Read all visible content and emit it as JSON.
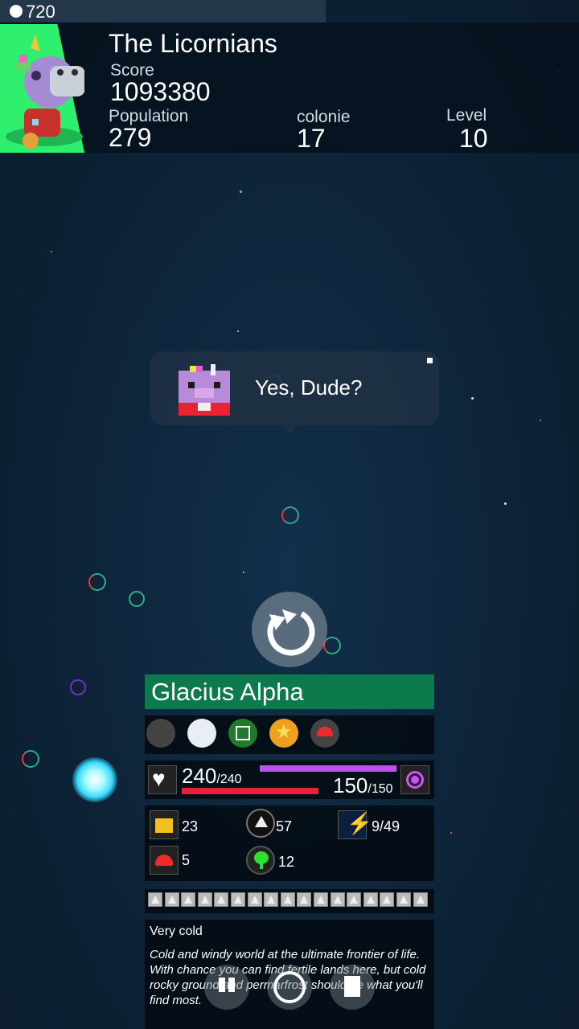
{
  "top_bar": {
    "coins": "720"
  },
  "header": {
    "civ_name": "The Licornians",
    "score_label": "Score",
    "score_value": "1093380",
    "population_label": "Population",
    "population_value": "279",
    "colonies_label": "colonie",
    "colonies_value": "17",
    "level_label": "Level",
    "level_value": "10"
  },
  "bubble": {
    "text": "Yes, Dude?"
  },
  "planet": {
    "name": "Glacius Alpha",
    "health_current": "240",
    "health_max": "/240",
    "health_fraction": 1.0,
    "energy_current": "150",
    "energy_max": "/150",
    "energy_fraction": 1.0,
    "stats": {
      "buildings": "23",
      "ships": "57",
      "energy": "9/49",
      "domes": "5",
      "trees": "12"
    },
    "description_title": "Very cold",
    "description_body": "Cold and windy world at the ultimate frontier of life. With chance you can find fertile lands here, but cold rocky ground and permarfrost should be what you'll find most."
  },
  "colors": {
    "header_bg": "#06121e",
    "name_bar": "#0c7a4c",
    "health_bar": "#e8203c",
    "energy_bar": "#c04ef0",
    "avatar_bg": "#2fef6e"
  }
}
